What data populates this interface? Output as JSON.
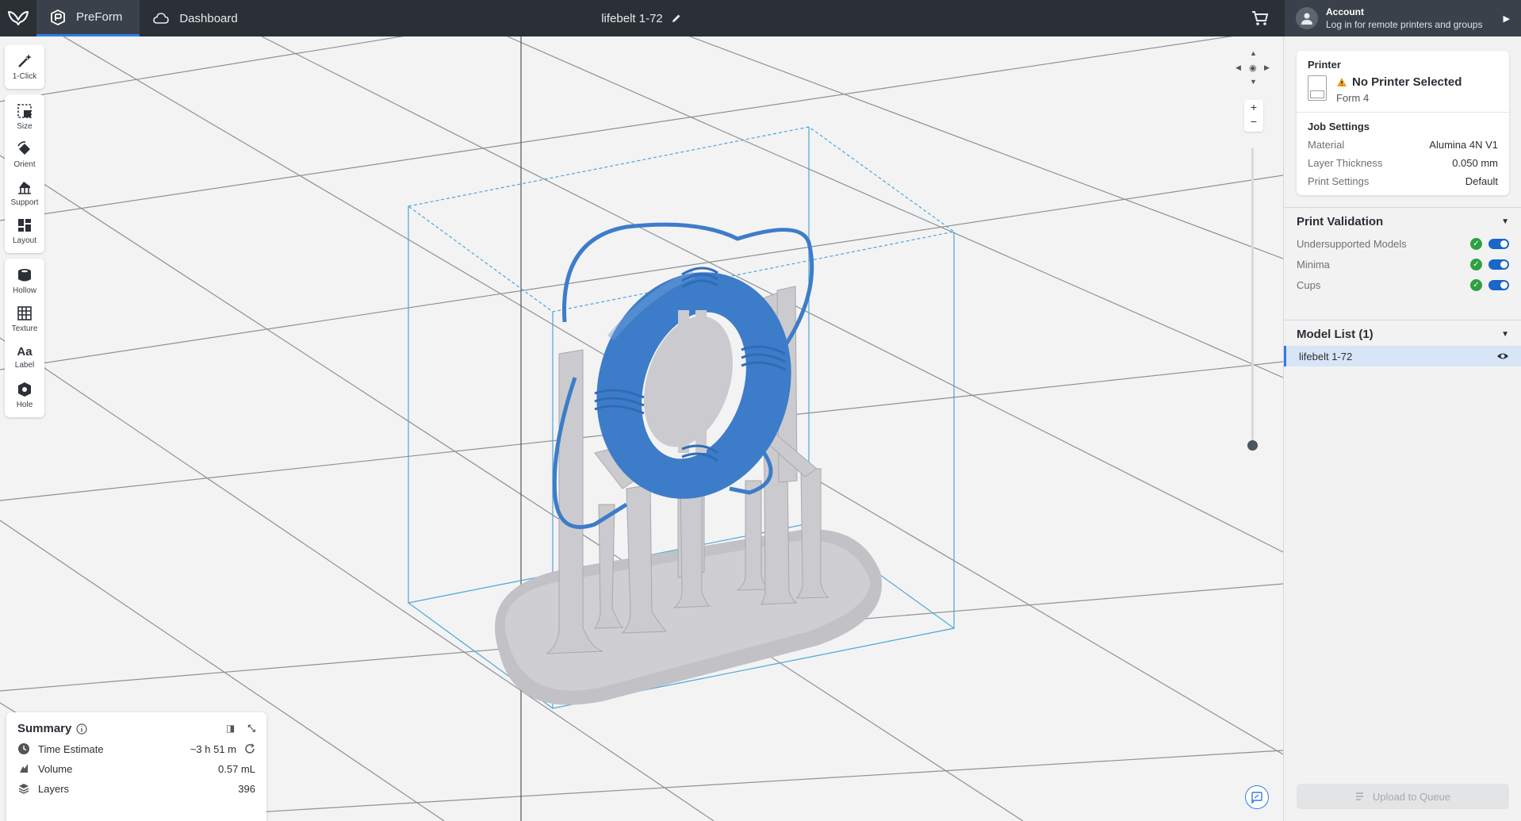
{
  "topbar": {
    "tabs": [
      {
        "label": "PreForm",
        "icon": "preform-icon",
        "active": true
      },
      {
        "label": "Dashboard",
        "icon": "cloud-icon",
        "active": false
      }
    ],
    "document_title": "lifebelt 1-72",
    "account": {
      "title": "Account",
      "subtitle": "Log in for remote printers and groups"
    }
  },
  "tools": [
    [
      {
        "label": "1-Click",
        "icon": "magic-wand-icon"
      }
    ],
    [
      {
        "label": "Size",
        "icon": "size-icon"
      },
      {
        "label": "Orient",
        "icon": "orient-icon"
      },
      {
        "label": "Support",
        "icon": "support-icon"
      },
      {
        "label": "Layout",
        "icon": "layout-icon"
      }
    ],
    [
      {
        "label": "Hollow",
        "icon": "hollow-icon"
      },
      {
        "label": "Texture",
        "icon": "texture-icon"
      },
      {
        "label": "Label",
        "icon": "label-icon",
        "glyph": "Aa"
      },
      {
        "label": "Hole",
        "icon": "hole-icon"
      }
    ]
  ],
  "summary": {
    "title": "Summary",
    "rows": [
      {
        "label": "Time Estimate",
        "value": "~3 h 51 m",
        "icon": "clock-icon"
      },
      {
        "label": "Volume",
        "value": "0.57 mL",
        "icon": "volume-icon"
      },
      {
        "label": "Layers",
        "value": "396",
        "icon": "layers-icon"
      }
    ]
  },
  "panel": {
    "printer_label": "Printer",
    "printer_status": "No Printer Selected",
    "printer_model": "Form 4",
    "job_settings_label": "Job Settings",
    "job_settings": [
      {
        "key": "Material",
        "value": "Alumina 4N V1"
      },
      {
        "key": "Layer Thickness",
        "value": "0.050 mm"
      },
      {
        "key": "Print Settings",
        "value": "Default"
      }
    ],
    "validation_title": "Print Validation",
    "validation": [
      {
        "label": "Undersupported Models",
        "enabled": true
      },
      {
        "label": "Minima",
        "enabled": true
      },
      {
        "label": "Cups",
        "enabled": true
      }
    ],
    "model_list_title": "Model List (1)",
    "models": [
      "lifebelt 1-72"
    ],
    "upload_label": "Upload to Queue"
  },
  "colors": {
    "accent": "#2f7de1",
    "model_blue": "#3d7cc9",
    "support_grey": "#c9c9cc",
    "topbar": "#2b3036"
  }
}
